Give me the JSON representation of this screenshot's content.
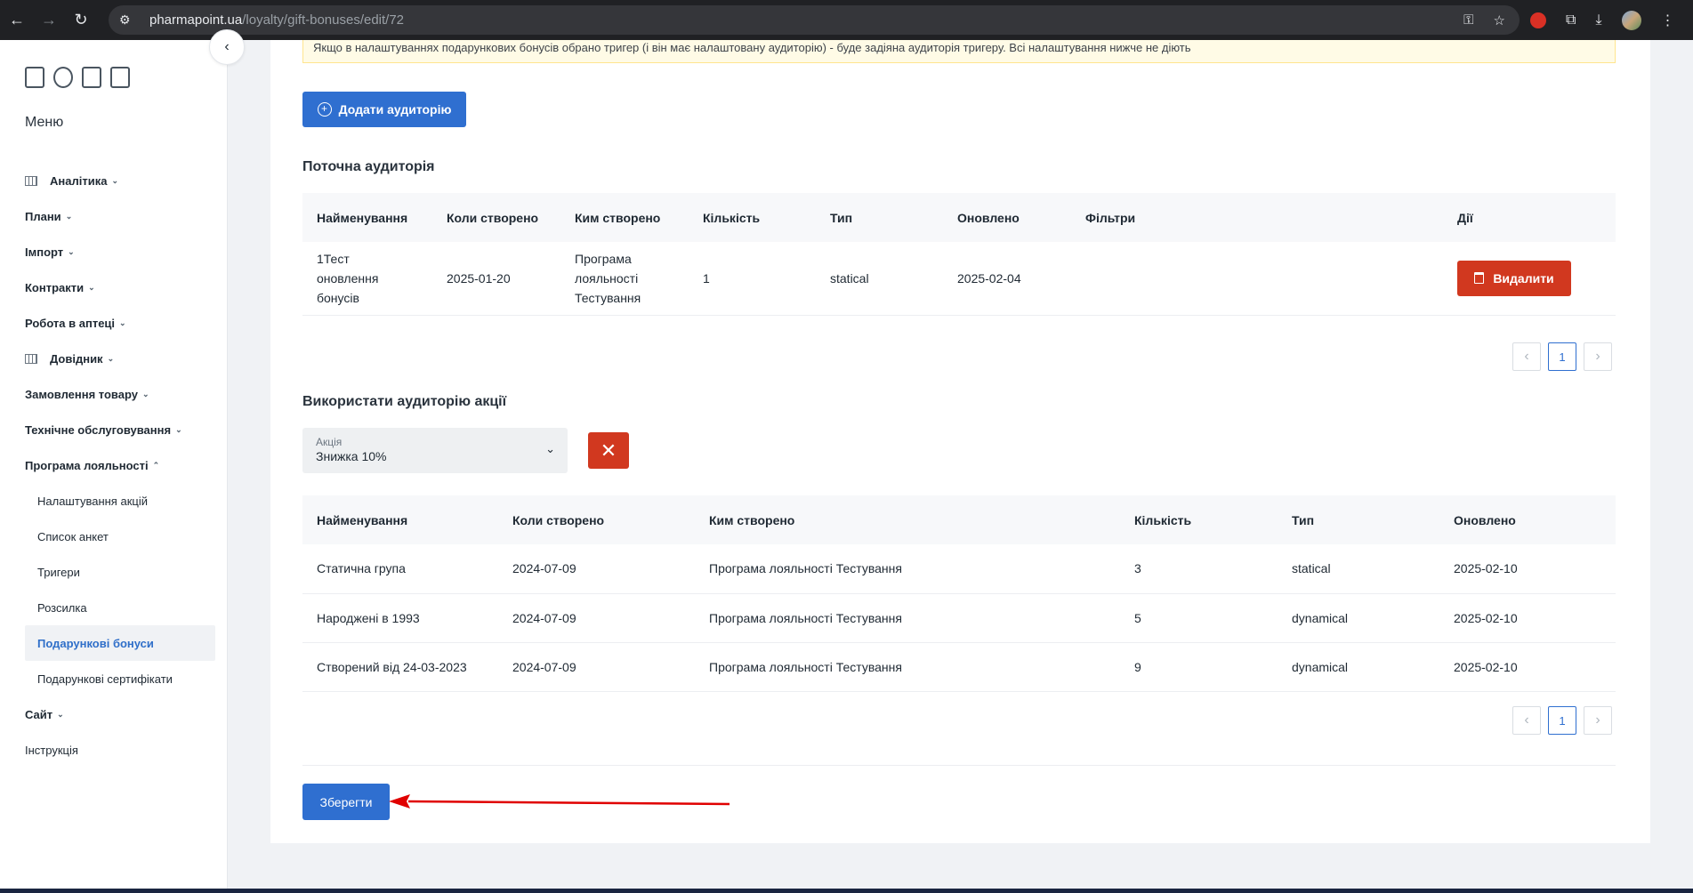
{
  "browser": {
    "url_host": "pharmapoint.ua",
    "url_path": "/loyalty/gift-bonuses/edit/72"
  },
  "sidebar": {
    "menu_title": "Меню",
    "items": [
      {
        "label": "Аналітика",
        "icon": "grid-icon",
        "expandable": true
      },
      {
        "label": "Плани",
        "expandable": true
      },
      {
        "label": "Імпорт",
        "expandable": true
      },
      {
        "label": "Контракти",
        "expandable": true
      },
      {
        "label": "Робота в аптеці",
        "expandable": true
      },
      {
        "label": "Довідник",
        "icon": "list-icon",
        "expandable": true
      },
      {
        "label": "Замовлення товару",
        "expandable": true
      },
      {
        "label": "Технічне обслуговування",
        "expandable": true
      },
      {
        "label": "Програма лояльності",
        "expandable": true,
        "expanded": true
      }
    ],
    "loyalty_sub": [
      "Налаштування акцій",
      "Список анкет",
      "Тригери",
      "Розсилка",
      "Подарункові бонуси",
      "Подарункові сертифікати"
    ],
    "active_sub": "Подарункові бонуси",
    "after_items": [
      {
        "label": "Сайт",
        "expandable": true
      },
      {
        "label": "Інструкція",
        "expandable": false
      }
    ]
  },
  "warning": "Якщо в налаштуваннях подарункових бонусів обрано тригер (і він має налаштовану аудиторію) - буде задіяна аудиторія тригеру. Всі налаштування нижче не діють",
  "add_audience_label": "Додати аудиторію",
  "current_audience": {
    "title": "Поточна аудиторія",
    "columns": [
      "Найменування",
      "Коли створено",
      "Ким створено",
      "Кількість",
      "Тип",
      "Оновлено",
      "Фільтри",
      "Дії"
    ],
    "rows": [
      {
        "name": "1Тест оновлення бонусів",
        "created": "2025-01-20",
        "by": "Програма лояльності Тестування",
        "count": "1",
        "type": "statical",
        "updated": "2025-02-04",
        "filters": "",
        "action": "Видалити"
      }
    ],
    "page": "1"
  },
  "promo_audience": {
    "title": "Використати аудиторію акції",
    "select_label": "Акція",
    "select_value": "Знижка 10%",
    "columns": [
      "Найменування",
      "Коли створено",
      "Ким створено",
      "Кількість",
      "Тип",
      "Оновлено"
    ],
    "rows": [
      {
        "name": "Статична група",
        "created": "2024-07-09",
        "by": "Програма лояльності Тестування",
        "count": "3",
        "type": "statical",
        "updated": "2025-02-10"
      },
      {
        "name": "Народжені в 1993",
        "created": "2024-07-09",
        "by": "Програма лояльності Тестування",
        "count": "5",
        "type": "dynamical",
        "updated": "2025-02-10"
      },
      {
        "name": "Створений від 24-03-2023",
        "created": "2024-07-09",
        "by": "Програма лояльності Тестування",
        "count": "9",
        "type": "dynamical",
        "updated": "2025-02-10"
      }
    ],
    "page": "1"
  },
  "save_label": "Зберегти",
  "colors": {
    "primary": "#2f6fd0",
    "danger": "#d1381f",
    "arrow": "#e00000",
    "active_menu": "#2f6fc9"
  }
}
